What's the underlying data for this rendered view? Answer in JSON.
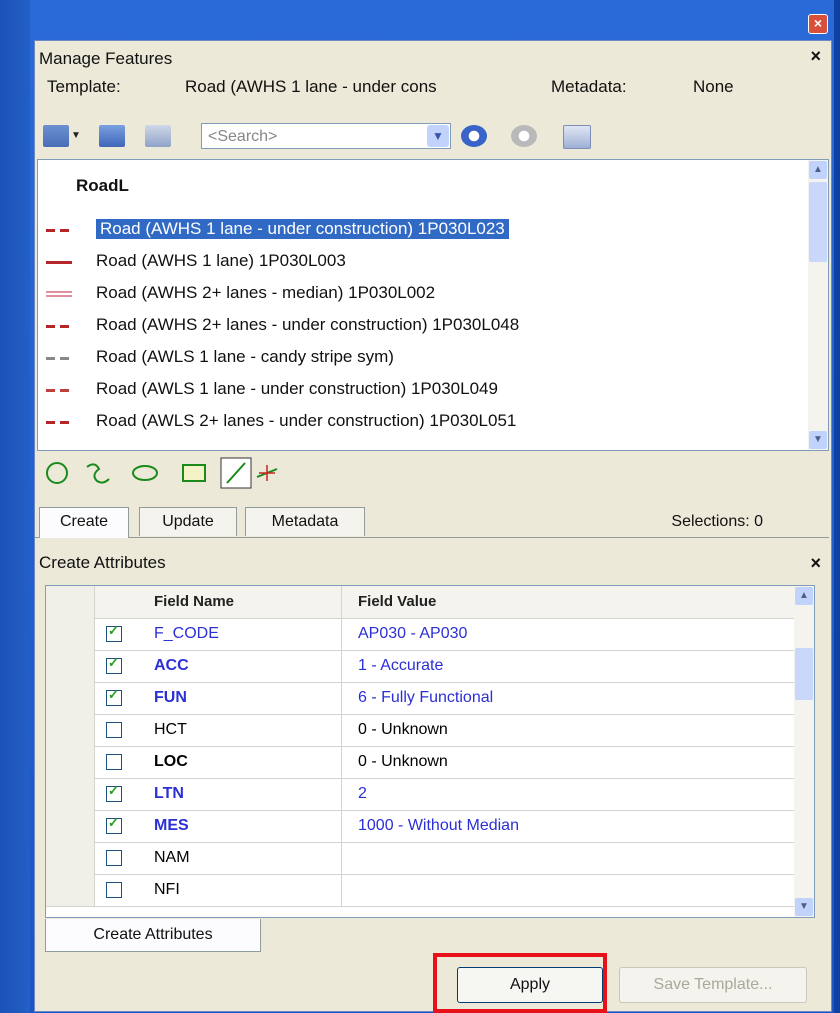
{
  "panel": {
    "title": "Manage Features",
    "template_label": "Template:",
    "template_value": "Road (AWHS 1 lane - under cons",
    "metadata_label": "Metadata:",
    "metadata_value": "None"
  },
  "search": {
    "placeholder": "<Search>"
  },
  "feature_list": {
    "header": "RoadL",
    "items": [
      {
        "label": "Road (AWHS 1 lane - under construction) 1P030L023",
        "sym_color": "#b5262b",
        "sym_style": "dashed"
      },
      {
        "label": "Road (AWHS 1 lane) 1P030L003",
        "sym_color": "#b5262b",
        "sym_style": "solid"
      },
      {
        "label": "Road (AWHS 2+ lanes - median) 1P030L002",
        "sym_color": "#e090a0",
        "sym_style": "double"
      },
      {
        "label": "Road (AWHS 2+ lanes - under construction) 1P030L048",
        "sym_color": "#b5262b",
        "sym_style": "dashed"
      },
      {
        "label": "Road (AWLS 1 lane - candy stripe sym)",
        "sym_color": "#888888",
        "sym_style": "dashed"
      },
      {
        "label": "Road (AWLS 1 lane - under construction) 1P030L049",
        "sym_color": "#c04040",
        "sym_style": "dashed"
      },
      {
        "label": "Road (AWLS 2+ lanes - under construction) 1P030L051",
        "sym_color": "#b5262b",
        "sym_style": "dashed"
      }
    ]
  },
  "tabs": {
    "create": "Create",
    "update": "Update",
    "metadata": "Metadata"
  },
  "selections": "Selections: 0",
  "create_attributes": {
    "title": "Create Attributes",
    "col_field": "Field Name",
    "col_value": "Field Value",
    "rows": [
      {
        "checked": true,
        "name": "F_CODE",
        "value": "AP030 - AP030",
        "blue": true,
        "bold": false
      },
      {
        "checked": true,
        "name": "ACC",
        "value": "1 - Accurate",
        "blue": true,
        "bold": true
      },
      {
        "checked": true,
        "name": "FUN",
        "value": "6 - Fully Functional",
        "blue": true,
        "bold": true
      },
      {
        "checked": false,
        "name": "HCT",
        "value": "0 - Unknown",
        "blue": false,
        "bold": false
      },
      {
        "checked": false,
        "name": "LOC",
        "value": "0 - Unknown",
        "blue": false,
        "bold": true
      },
      {
        "checked": true,
        "name": "LTN",
        "value": "2",
        "blue": true,
        "bold": true
      },
      {
        "checked": true,
        "name": "MES",
        "value": "1000 - Without Median",
        "blue": true,
        "bold": true
      },
      {
        "checked": false,
        "name": "NAM",
        "value": "",
        "blue": false,
        "bold": false
      },
      {
        "checked": false,
        "name": "NFI",
        "value": "",
        "blue": false,
        "bold": false
      }
    ],
    "tab_label": "Create Attributes"
  },
  "buttons": {
    "apply": "Apply",
    "save_template": "Save Template..."
  }
}
